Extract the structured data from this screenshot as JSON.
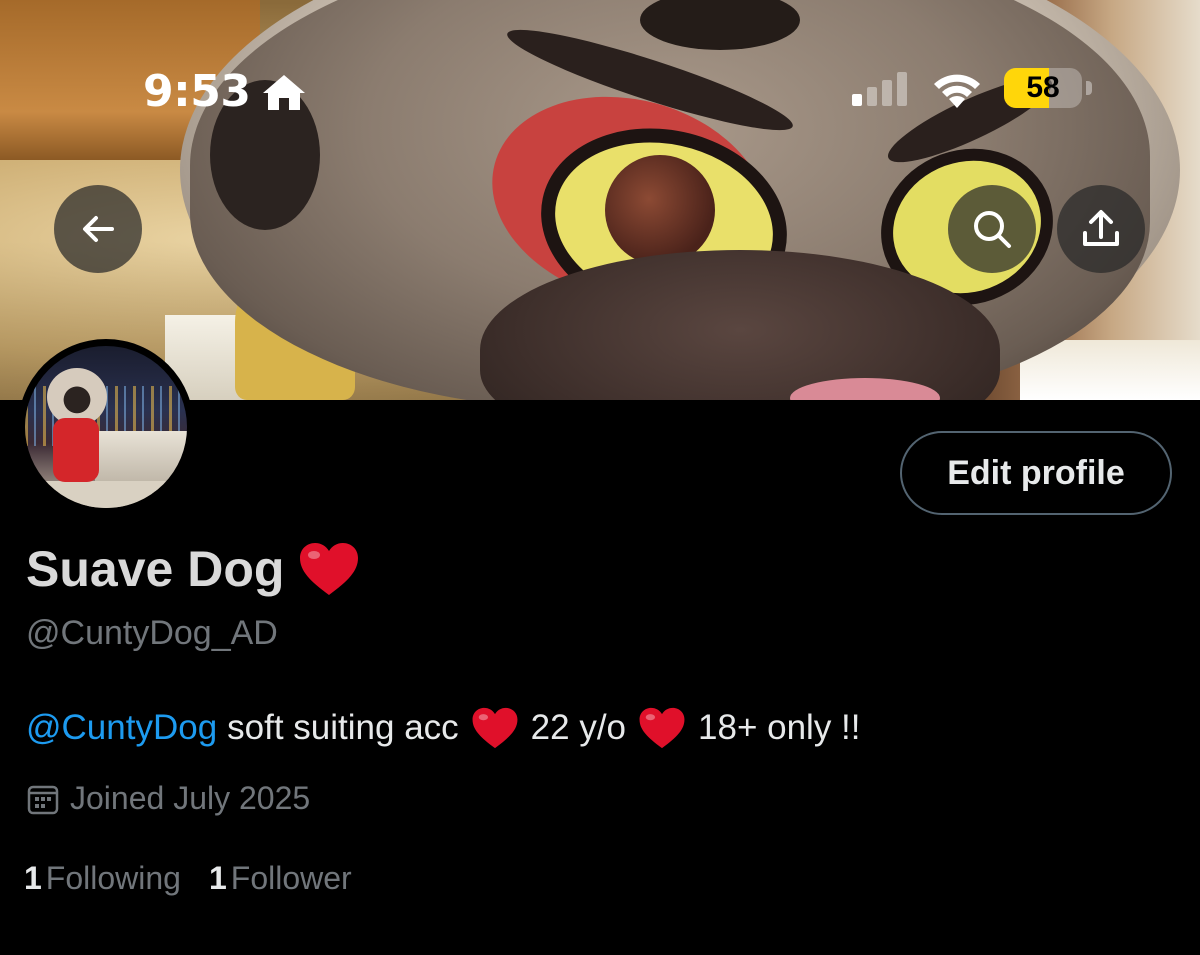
{
  "status_bar": {
    "time": "9:53",
    "battery": "58",
    "battery_level_percent": 58,
    "accent": "#ffd60a"
  },
  "header": {
    "back_icon": "arrow-left-icon",
    "search_icon": "search-icon",
    "share_icon": "share-icon"
  },
  "profile": {
    "edit_button_label": "Edit profile",
    "display_name": "Suave Dog",
    "handle": "@CuntyDog_AD",
    "bio": {
      "mention": "@CuntyDog",
      "part1": "soft suiting acc",
      "part2": "22 y/o",
      "part3": "18+ only !!"
    },
    "joined": "Joined July 2025",
    "following_count": "1",
    "following_label": "Following",
    "followers_count": "1",
    "followers_label": "Follower"
  },
  "colors": {
    "background": "#000000",
    "text": "#e7e9ea",
    "muted": "#71767b",
    "link": "#1d9bf0",
    "heart": "#e0102a"
  }
}
